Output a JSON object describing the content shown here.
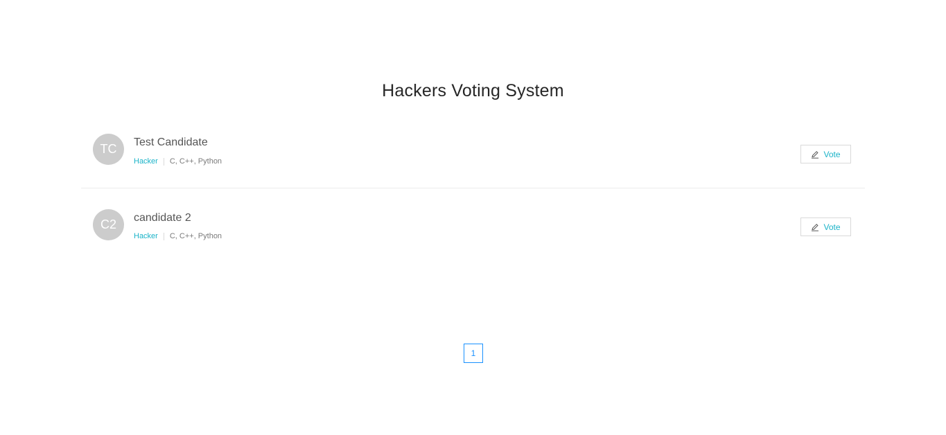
{
  "page": {
    "title": "Hackers Voting System"
  },
  "candidates": [
    {
      "initials": "TC",
      "name": "Test Candidate",
      "role": "Hacker",
      "skills": "C, C++, Python",
      "vote_label": "Vote"
    },
    {
      "initials": "C2",
      "name": "candidate 2",
      "role": "Hacker",
      "skills": "C, C++, Python",
      "vote_label": "Vote"
    }
  ],
  "pagination": {
    "current_page": "1"
  },
  "colors": {
    "accent": "#1ab3c8",
    "pager": "#1890ff",
    "avatar": "#cccccc",
    "title": "#262626"
  },
  "icons": {
    "vote": "edit-icon"
  }
}
